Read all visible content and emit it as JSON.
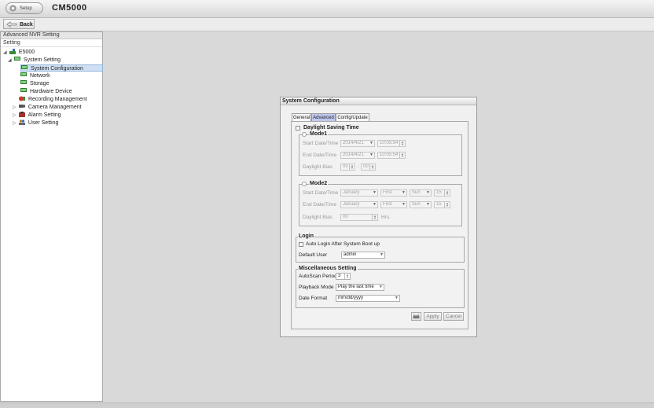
{
  "app": {
    "setup_label": "Setup",
    "title": "CM5000"
  },
  "toolbar": {
    "back_label": "Back"
  },
  "sidebar": {
    "header": "Advanced NVR Setting",
    "subheader": "Setting",
    "tree": [
      {
        "label": "E5000",
        "expander": "◢"
      },
      {
        "label": "System Setting",
        "expander": "◢"
      },
      {
        "label": "System Configuration",
        "selected": true
      },
      {
        "label": "Network"
      },
      {
        "label": "Storage"
      },
      {
        "label": "Hardware Device"
      },
      {
        "label": "Recording Management"
      },
      {
        "label": "Camera Management",
        "expander": "▷"
      },
      {
        "label": "Alarm Setting",
        "expander": "▷"
      },
      {
        "label": "User Setting",
        "expander": "▷"
      }
    ]
  },
  "dialog": {
    "title": "System Configuration",
    "tabs": [
      {
        "label": "General"
      },
      {
        "label": "Advanced",
        "active": true
      },
      {
        "label": "Config/Update"
      }
    ],
    "dst": {
      "label": "Daylight Saving Time",
      "mode1": {
        "label": "Mode1",
        "start_label": "Start Date/Time",
        "start_date": "2014/4/21",
        "start_time": "10:05:54",
        "end_label": "End Date/Time",
        "end_date": "2014/4/21",
        "end_time": "10:05:54",
        "bias_label": "Daylight Bias",
        "bias_hours": "00",
        "bias_sep": ":",
        "bias_minutes": "00"
      },
      "mode2": {
        "label": "Mode2",
        "start_label": "Start Date/Time",
        "start_month": "January",
        "start_week": "First",
        "start_day": "Sun",
        "start_hour": "15",
        "end_label": "End Date/Time",
        "end_month": "January",
        "end_week": "First",
        "end_day": "Sun",
        "end_hour": "15",
        "bias_label": "Daylight Bias",
        "bias_value": "00",
        "bias_unit": "Hrs."
      }
    },
    "login": {
      "label": "Login",
      "auto_login_label": "Auto Login After System Boot up",
      "default_user_label": "Default User",
      "default_user_value": "admin"
    },
    "misc": {
      "label": "Miscellaneous Setting",
      "autoscan_label": "AutoScan Period",
      "autoscan_value": "3",
      "playback_label": "Playback Mode",
      "playback_value": "Play the last time",
      "date_format_label": "Date Format",
      "date_format_value": "mm/dd/yyyy"
    },
    "buttons": {
      "apply": "Apply",
      "cancel": "Cancel"
    }
  }
}
